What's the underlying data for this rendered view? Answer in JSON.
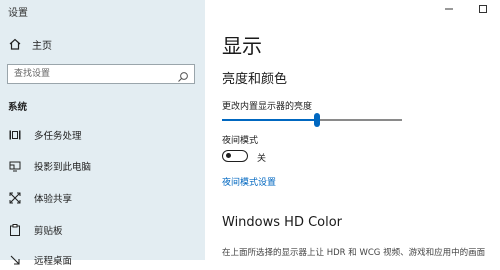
{
  "window": {
    "app_title": "设置",
    "controls": [
      {
        "icon": "minimize-icon"
      },
      {
        "icon": "maximize-icon"
      }
    ]
  },
  "sidebar": {
    "home_label": "主页",
    "home_icon": "home-icon",
    "search_placeholder": "查找设置",
    "search_icon": "search-icon",
    "section_title": "系统",
    "items": [
      {
        "label": "多任务处理",
        "icon": "multitasking-icon"
      },
      {
        "label": "投影到此电脑",
        "icon": "project-icon"
      },
      {
        "label": "体验共享",
        "icon": "shared-experiences-icon"
      },
      {
        "label": "剪贴板",
        "icon": "clipboard-icon"
      },
      {
        "label": "远程桌面",
        "icon": "remote-desktop-icon"
      }
    ]
  },
  "main": {
    "title": "显示",
    "brightness_section": "亮度和颜色",
    "brightness_label": "更改内置显示器的亮度",
    "brightness_value": 0.53,
    "night_light_label": "夜间模式",
    "night_light_state": "关",
    "night_light_link": "夜间模式设置",
    "hd_title": "Windows HD Color",
    "hd_desc": "在上面所选择的显示器上让 HDR 和 WCG 视频、游戏和应用中的画面"
  },
  "colors": {
    "accent": "#0067c0",
    "sidebar_bg": "#e3edf2"
  }
}
